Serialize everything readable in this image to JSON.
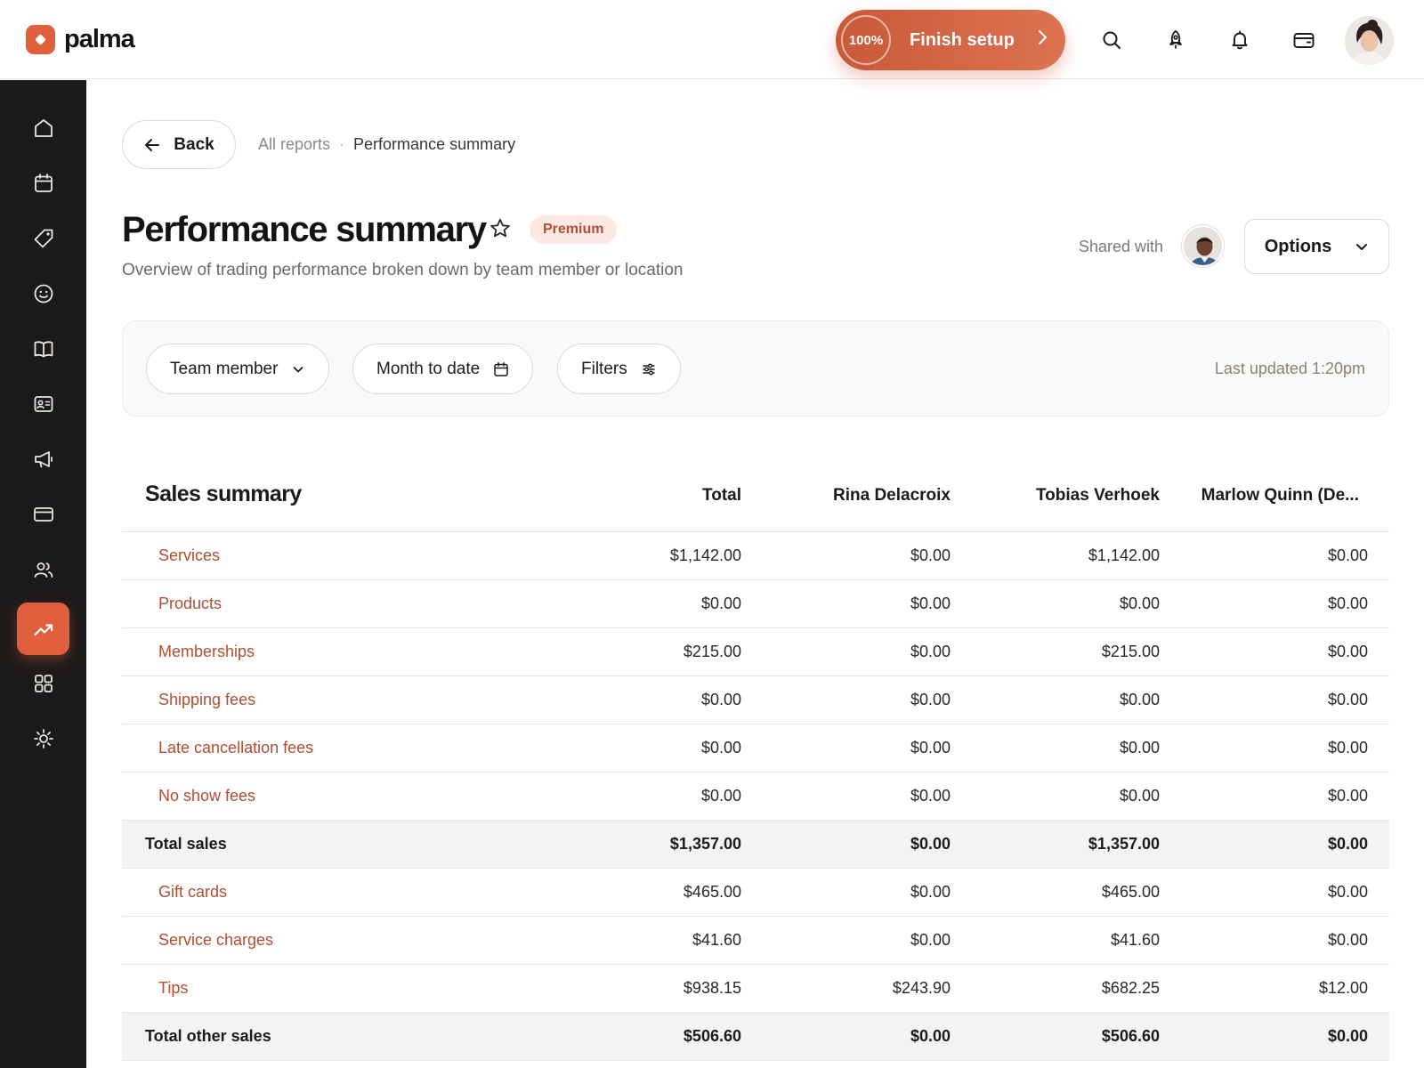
{
  "app": {
    "brand": "palma",
    "accent_color": "#e0603e"
  },
  "topbar": {
    "setup": {
      "progress_label": "100%",
      "label": "Finish setup"
    },
    "icons": [
      "search-icon",
      "rocket-icon",
      "bell-icon",
      "wallet-icon"
    ]
  },
  "sidebar": {
    "items": [
      {
        "icon": "home-icon"
      },
      {
        "icon": "calendar-icon"
      },
      {
        "icon": "tag-icon"
      },
      {
        "icon": "smiley-icon"
      },
      {
        "icon": "book-icon"
      },
      {
        "icon": "contact-card-icon"
      },
      {
        "icon": "megaphone-icon"
      },
      {
        "icon": "credit-card-icon"
      },
      {
        "icon": "people-icon"
      },
      {
        "icon": "trend-up-icon",
        "active": true
      },
      {
        "icon": "apps-grid-icon"
      },
      {
        "icon": "settings-icon"
      }
    ]
  },
  "nav": {
    "back_label": "Back",
    "breadcrumb": {
      "parent": "All reports",
      "separator": "·",
      "current": "Performance summary"
    }
  },
  "header": {
    "title": "Performance summary",
    "badge": "Premium",
    "subtitle": "Overview of trading performance broken down by team member or location",
    "shared_with_label": "Shared with",
    "options_label": "Options"
  },
  "filters": {
    "group_by": "Team member",
    "date_range": "Month to date",
    "filters_label": "Filters",
    "last_updated": "Last updated 1:20pm"
  },
  "table": {
    "title": "Sales summary",
    "columns": [
      "Total",
      "Rina Delacroix",
      "Tobias Verhoek",
      "Marlow Quinn (De..."
    ],
    "rows": [
      {
        "label": "Services",
        "values": [
          "$1,142.00",
          "$0.00",
          "$1,142.00",
          "$0.00"
        ]
      },
      {
        "label": "Products",
        "values": [
          "$0.00",
          "$0.00",
          "$0.00",
          "$0.00"
        ]
      },
      {
        "label": "Memberships",
        "values": [
          "$215.00",
          "$0.00",
          "$215.00",
          "$0.00"
        ]
      },
      {
        "label": "Shipping fees",
        "values": [
          "$0.00",
          "$0.00",
          "$0.00",
          "$0.00"
        ]
      },
      {
        "label": "Late cancellation fees",
        "values": [
          "$0.00",
          "$0.00",
          "$0.00",
          "$0.00"
        ]
      },
      {
        "label": "No show fees",
        "values": [
          "$0.00",
          "$0.00",
          "$0.00",
          "$0.00"
        ]
      },
      {
        "label": "Total sales",
        "values": [
          "$1,357.00",
          "$0.00",
          "$1,357.00",
          "$0.00"
        ],
        "total": true
      },
      {
        "label": "Gift cards",
        "values": [
          "$465.00",
          "$0.00",
          "$465.00",
          "$0.00"
        ]
      },
      {
        "label": "Service charges",
        "values": [
          "$41.60",
          "$0.00",
          "$41.60",
          "$0.00"
        ]
      },
      {
        "label": "Tips",
        "values": [
          "$938.15",
          "$243.90",
          "$682.25",
          "$12.00"
        ]
      },
      {
        "label": "Total other sales",
        "values": [
          "$506.60",
          "$0.00",
          "$506.60",
          "$0.00"
        ],
        "total": true
      }
    ]
  }
}
